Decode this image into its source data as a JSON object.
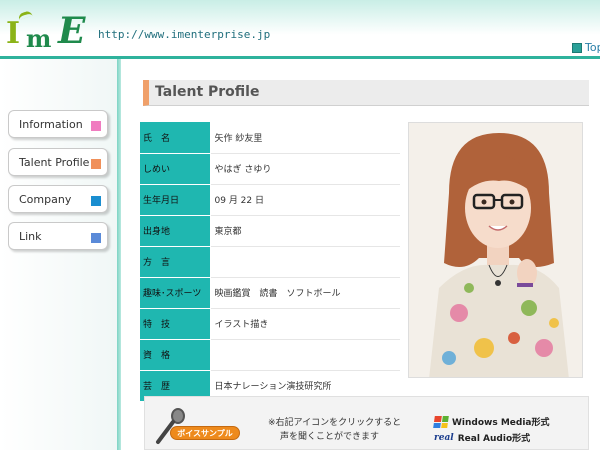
{
  "header": {
    "logo_text": "I'mE",
    "url": "http://www.imenterprise.jp",
    "top_link": "Top"
  },
  "nav": {
    "items": [
      {
        "label": "Information",
        "color": "#f07cc0"
      },
      {
        "label": "Talent Profile",
        "color": "#f0905a"
      },
      {
        "label": "Company",
        "color": "#1a8ed0"
      },
      {
        "label": "Link",
        "color": "#5a8ad8"
      }
    ]
  },
  "main": {
    "title": "Talent Profile",
    "profile": [
      {
        "label": "氏　名",
        "value": "矢作 紗友里"
      },
      {
        "label": "しめい",
        "value": "やはぎ さゆり"
      },
      {
        "label": "生年月日",
        "value": "09 月 22 日"
      },
      {
        "label": "出身地",
        "value": "東京都"
      },
      {
        "label": "方　言",
        "value": ""
      },
      {
        "label": "趣味･スポーツ",
        "value": "映画鑑賞　読書　ソフトボール"
      },
      {
        "label": "特　技",
        "value": "イラスト描き"
      },
      {
        "label": "資　格",
        "value": ""
      },
      {
        "label": "芸　歴",
        "value": "日本ナレーション演技研究所"
      }
    ],
    "voice": {
      "badge": "ボイスサンプル",
      "note_line1": "※右記アイコンをクリックすると",
      "note_line2": "声を聞くことができます",
      "windows_media": "Windows Media形式",
      "real_audio_logo": "real",
      "real_audio": "Real Audio形式"
    }
  }
}
